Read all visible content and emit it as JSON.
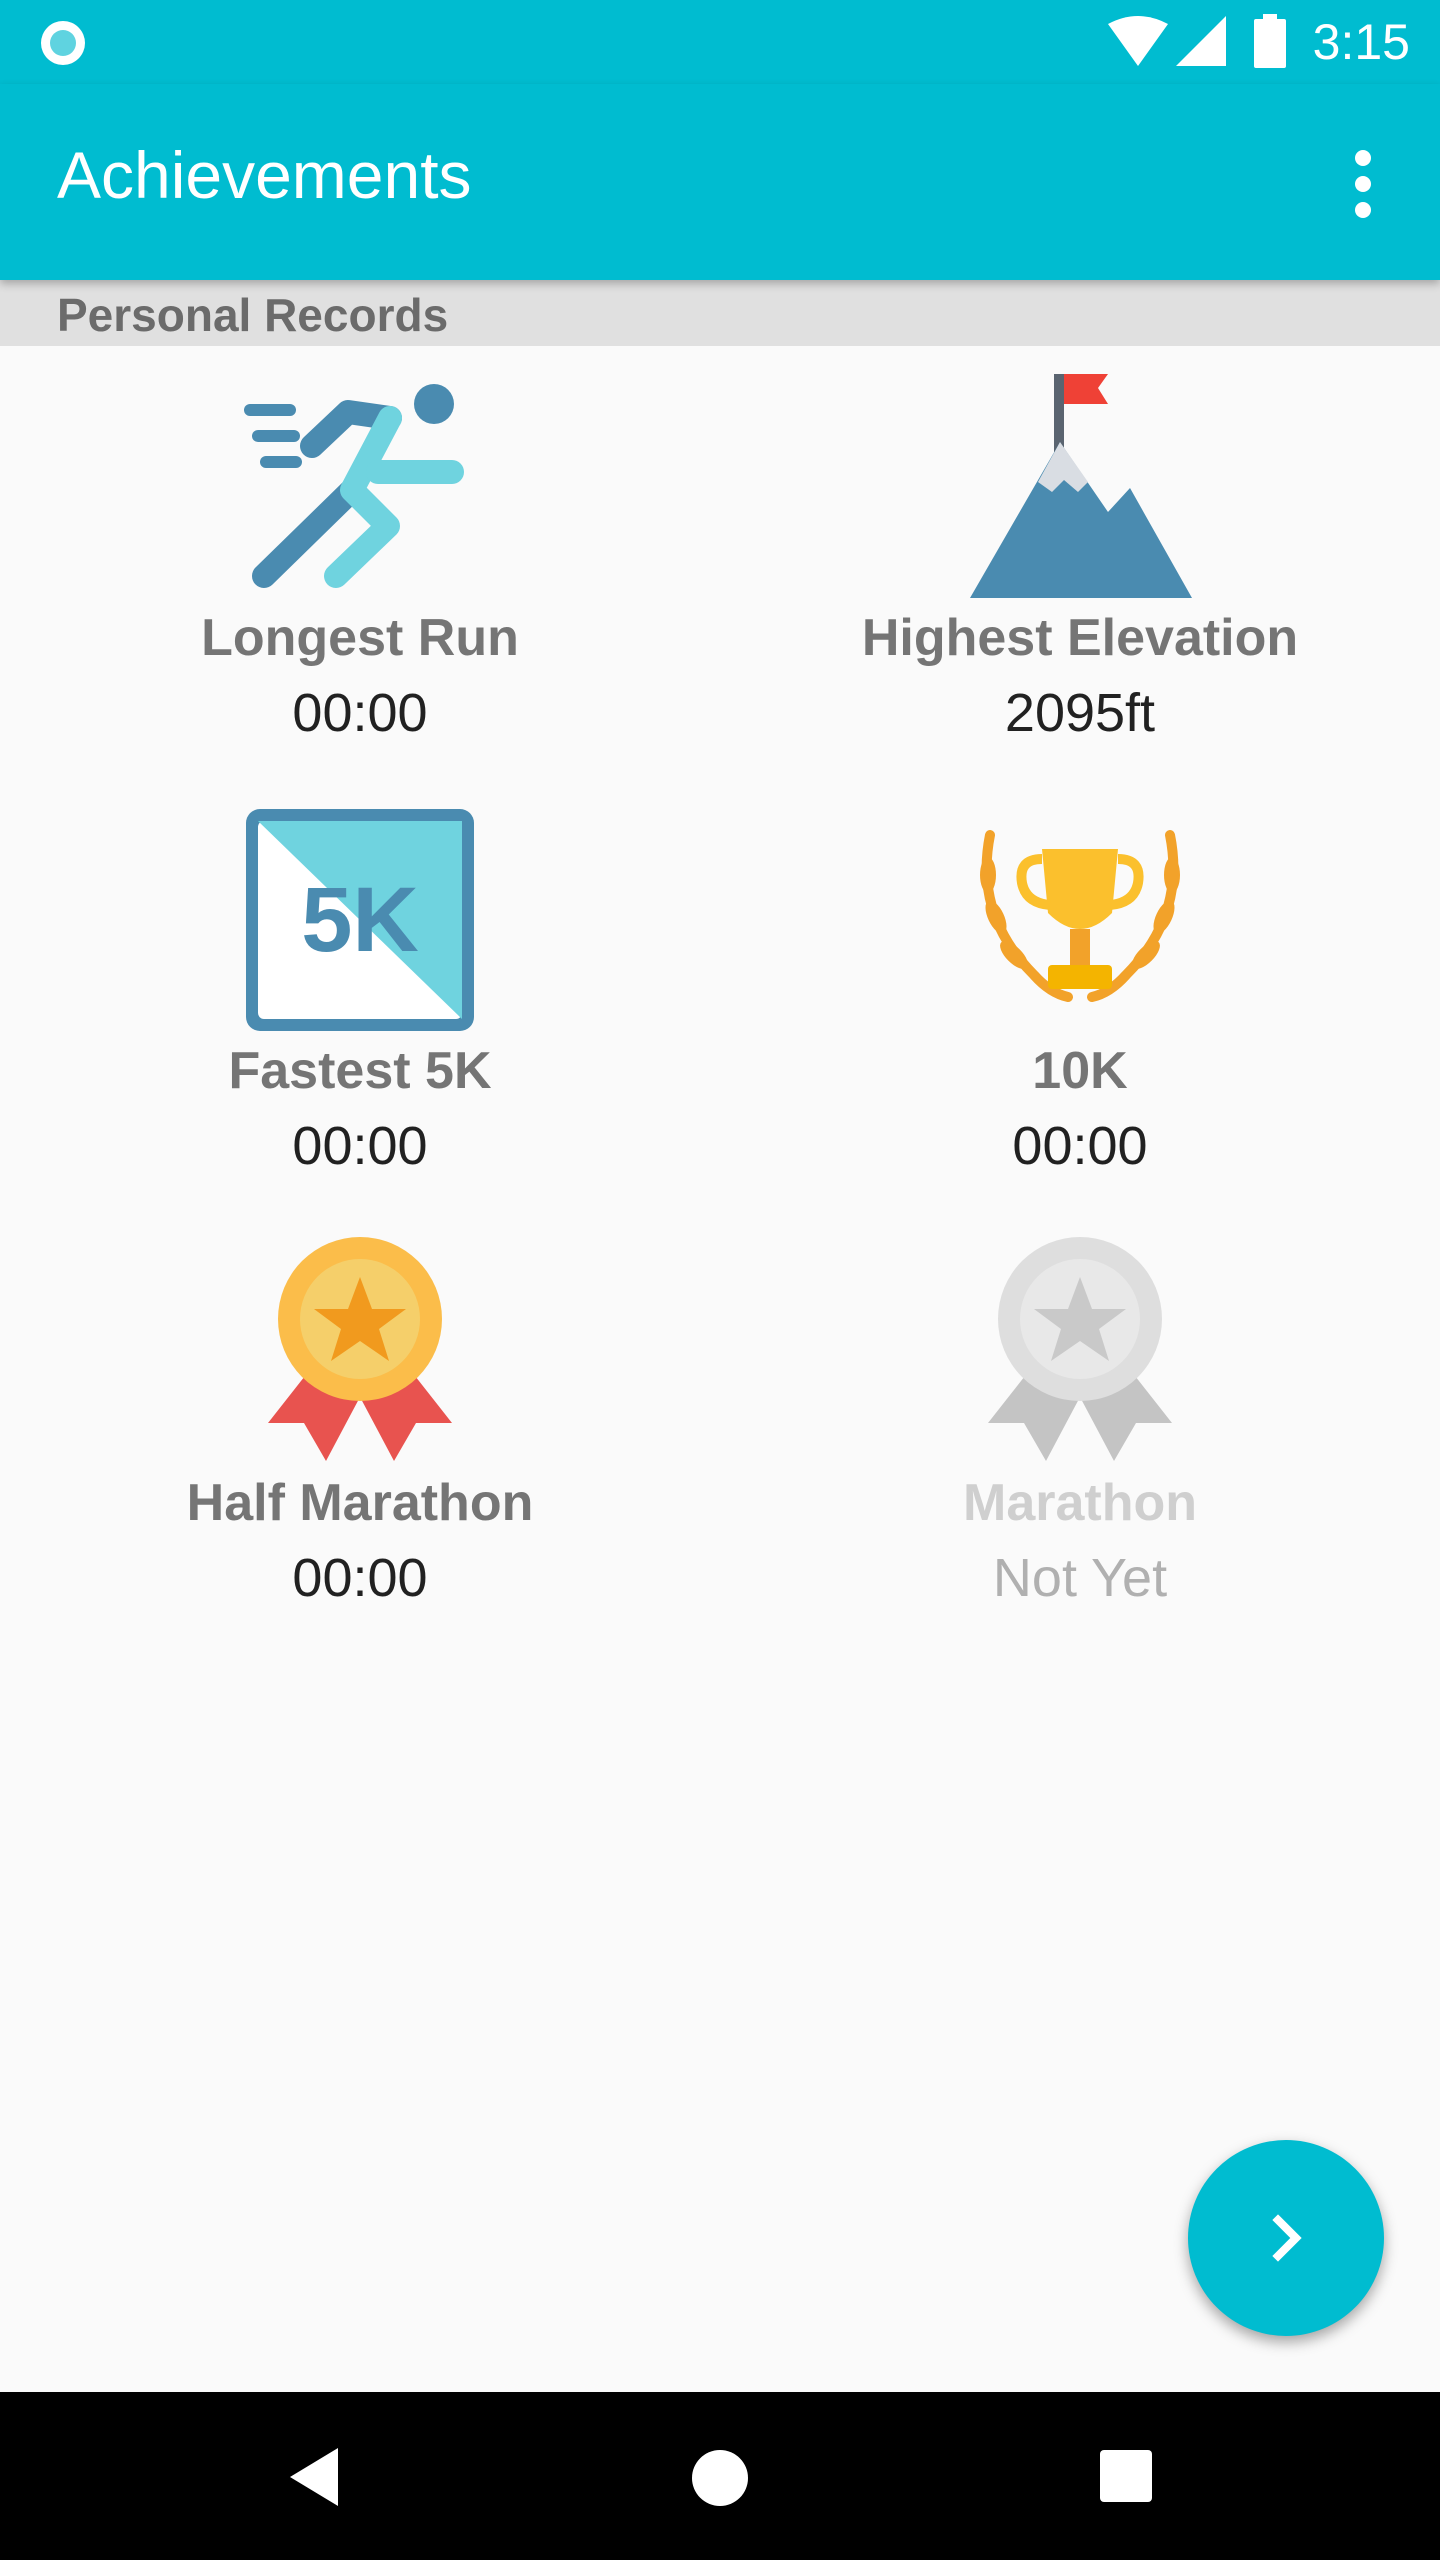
{
  "status_bar": {
    "time": "3:15",
    "icons": [
      "camera-dot-icon",
      "wifi-icon",
      "signal-icon",
      "battery-icon"
    ]
  },
  "app_bar": {
    "title": "Achievements",
    "menu_icon": "more-vert-icon"
  },
  "section": {
    "title": "Personal Records"
  },
  "records": [
    {
      "label": "Longest Run",
      "value": "00:00",
      "icon": "runner-icon",
      "locked": false
    },
    {
      "label": "Highest Elevation",
      "value": "2095ft",
      "icon": "mountain-flag-icon",
      "locked": false
    },
    {
      "label": "Fastest 5K",
      "value": "00:00",
      "icon": "5k-badge-icon",
      "locked": false
    },
    {
      "label": "10K",
      "value": "00:00",
      "icon": "trophy-icon",
      "locked": false
    },
    {
      "label": "Half Marathon",
      "value": "00:00",
      "icon": "gold-medal-icon",
      "locked": false
    },
    {
      "label": "Marathon",
      "value": "Not Yet",
      "icon": "grey-medal-icon",
      "locked": true
    }
  ],
  "badge_text": "5K",
  "fab": {
    "icon": "chevron-right-icon"
  },
  "nav_bar": {
    "icons": [
      "back-icon",
      "home-icon",
      "recents-icon"
    ]
  },
  "colors": {
    "primary": "#00bcd0",
    "section_bg": "#e0e0e0",
    "label": "#757575",
    "value": "#212121",
    "locked_label": "#cfcfcf",
    "locked_value": "#b0b0b0"
  }
}
